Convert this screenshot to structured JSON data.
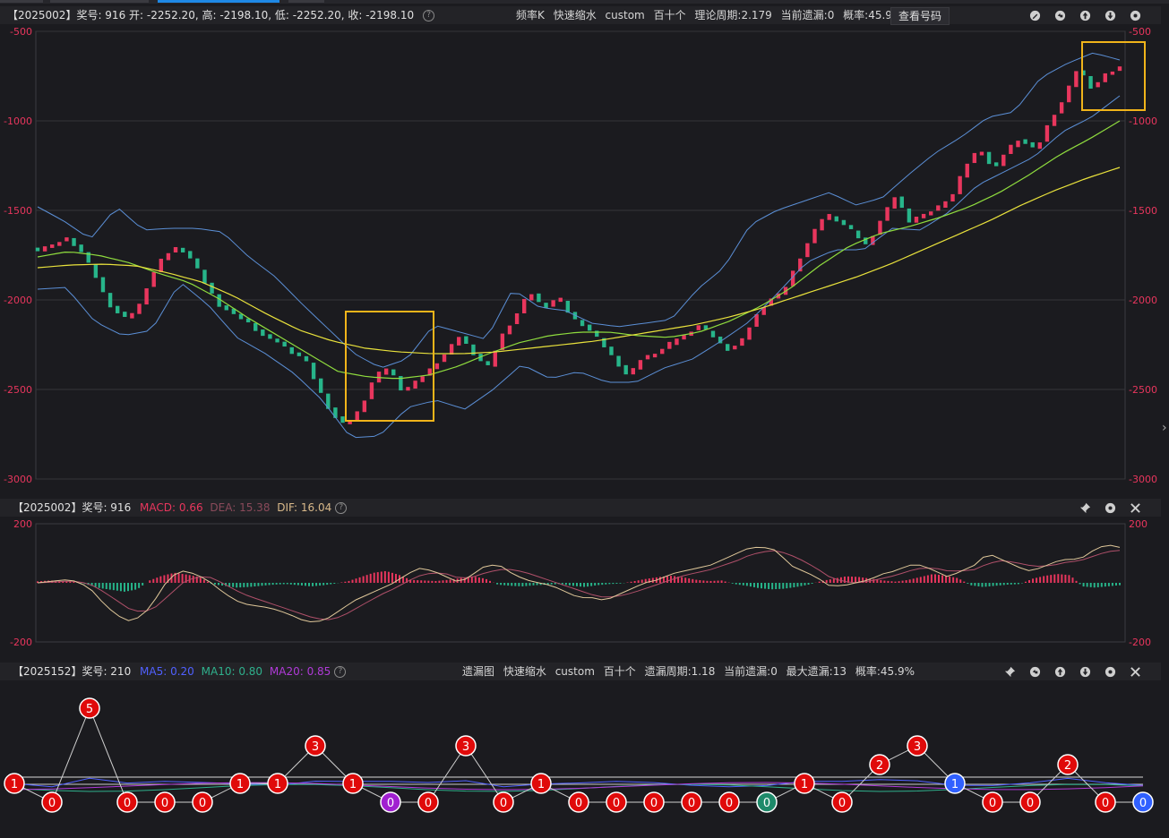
{
  "price_panel": {
    "info": "【2025002】奖号: 916   开: -2252.20, 高: -2198.10, 低: -2252.20, 收: -2198.10",
    "mode_items": [
      "频率K",
      "快速缩水",
      "custom",
      "百十个",
      "理论周期:2.179",
      "当前遗漏:0",
      "概率:45.9%"
    ],
    "view_button": "查看号码",
    "y_ticks": [
      "-500",
      "-1000",
      "-1500",
      "-2000",
      "-2500",
      "-3000"
    ]
  },
  "macd_panel": {
    "title": "【2025002】奖号: 916",
    "macd_text": "MACD: 0.66",
    "dea_text": "DEA: 15.38",
    "dif_text": "DIF: 16.04",
    "y_ticks": [
      "200",
      "-200"
    ]
  },
  "miss_panel": {
    "title": "【2025152】奖号: 210",
    "ma5_text": "MA5: 0.20",
    "ma10_text": "MA10: 0.80",
    "ma20_text": "MA20: 0.85",
    "mode_items": [
      "遗漏图",
      "快速缩水",
      "custom",
      "百十个",
      "遗漏周期:1.18",
      "当前遗漏:0",
      "最大遗漏:13",
      "概率:45.9%"
    ]
  },
  "colors": {
    "up": "#e8365d",
    "down": "#27b58a",
    "ma_yellow": "#e9e23c",
    "ma_green": "#8fdc3e",
    "boll": "#5b8fd6",
    "highlight": "#f0b41a",
    "macd_label": "#e8365d",
    "dea_label": "#8a4a5a",
    "dif_label": "#d9b98a",
    "ma5_label": "#5060ff",
    "ma10_label": "#2fb08c",
    "ma20_label": "#b03ad8",
    "node_red": "#e00a0a",
    "node_purple": "#a020d0",
    "node_green": "#1e8a6a",
    "node_blue": "#3060ff"
  },
  "chart_data": [
    {
      "type": "candlestick",
      "title": "",
      "ylim": [
        -3000,
        -500
      ],
      "yticks": [
        -500,
        -1000,
        -1500,
        -2000,
        -2500,
        -3000
      ],
      "grid": true,
      "last_bar": {
        "open": -2252.2,
        "high": -2198.1,
        "low": -2252.2,
        "close": -2198.1
      },
      "close_path": [
        -1720,
        -1700,
        -1650,
        -1720,
        -1850,
        -2020,
        -2100,
        -2070,
        -1880,
        -1750,
        -1700,
        -1780,
        -1920,
        -2040,
        -2080,
        -2130,
        -2200,
        -2230,
        -2290,
        -2330,
        -2500,
        -2650,
        -2700,
        -2600,
        -2420,
        -2380,
        -2520,
        -2450,
        -2380,
        -2300,
        -2200,
        -2300,
        -2380,
        -2200,
        -2090,
        -1950,
        -2050,
        -1980,
        -2100,
        -2150,
        -2230,
        -2330,
        -2430,
        -2320,
        -2300,
        -2240,
        -2200,
        -2140,
        -2200,
        -2280,
        -2240,
        -2100,
        -2000,
        -1960,
        -1800,
        -1650,
        -1520,
        -1560,
        -1620,
        -1700,
        -1550,
        -1420,
        -1560,
        -1530,
        -1480,
        -1430,
        -1250,
        -1150,
        -1280,
        -1150,
        -1100,
        -1170,
        -1000,
        -880,
        -700,
        -820,
        -740,
        -700
      ],
      "ma_yellow": [
        -1820,
        -1805,
        -1800,
        -1810,
        -1850,
        -1900,
        -1980,
        -2080,
        -2170,
        -2230,
        -2270,
        -2290,
        -2300,
        -2300,
        -2290,
        -2270,
        -2250,
        -2230,
        -2200,
        -2170,
        -2140,
        -2100,
        -2050,
        -1990,
        -1930,
        -1870,
        -1800,
        -1720,
        -1640,
        -1560,
        -1470,
        -1390,
        -1320,
        -1260
      ],
      "ma_green": [
        -1760,
        -1730,
        -1750,
        -1790,
        -1850,
        -1900,
        -1990,
        -2100,
        -2200,
        -2300,
        -2400,
        -2430,
        -2440,
        -2420,
        -2370,
        -2300,
        -2240,
        -2200,
        -2180,
        -2180,
        -2200,
        -2210,
        -2180,
        -2120,
        -2040,
        -1940,
        -1810,
        -1700,
        -1630,
        -1590,
        -1540,
        -1480,
        -1400,
        -1300,
        -1190,
        -1100,
        -1000
      ],
      "boll_upper": [
        -1480,
        -1560,
        -1660,
        -1480,
        -1610,
        -1600,
        -1600,
        -1620,
        -1760,
        -1870,
        -2020,
        -2160,
        -2300,
        -2380,
        -2330,
        -2140,
        -2180,
        -2220,
        -1940,
        -2040,
        -2060,
        -2130,
        -2150,
        -2130,
        -2110,
        -1940,
        -1820,
        -1580,
        -1500,
        -1450,
        -1400,
        -1470,
        -1430,
        -1300,
        -1180,
        -1090,
        -980,
        -950,
        -760,
        -680,
        -620,
        -660
      ],
      "boll_lower": [
        -1940,
        -1930,
        -2120,
        -2200,
        -2170,
        -1900,
        -2030,
        -2210,
        -2300,
        -2410,
        -2560,
        -2770,
        -2760,
        -2600,
        -2560,
        -2610,
        -2500,
        -2360,
        -2440,
        -2400,
        -2460,
        -2460,
        -2380,
        -2330,
        -2230,
        -2120,
        -1960,
        -1790,
        -1720,
        -1720,
        -1600,
        -1610,
        -1510,
        -1360,
        -1280,
        -1200,
        -1060,
        -980,
        -860
      ]
    },
    {
      "type": "macd",
      "ylim": [
        -200,
        200
      ],
      "yticks": [
        200,
        -200
      ],
      "series": [
        {
          "name": "MACD",
          "value": 0.66
        },
        {
          "name": "DEA",
          "value": 15.38
        },
        {
          "name": "DIF",
          "value": 16.04
        }
      ],
      "hist": [
        5,
        8,
        6,
        4,
        -6,
        -18,
        -24,
        -30,
        -22,
        8,
        24,
        34,
        28,
        20,
        -4,
        -10,
        -16,
        -14,
        -10,
        -6,
        -4,
        -8,
        -12,
        -8,
        -2,
        6,
        20,
        34,
        40,
        28,
        10,
        8,
        6,
        10,
        16,
        22,
        14,
        -6,
        -10,
        -12,
        -8,
        -6,
        -4,
        -10,
        -14,
        -8,
        -4,
        -2,
        6,
        14,
        20,
        24,
        18,
        10,
        6,
        8,
        -4,
        -10,
        -18,
        -22,
        -20,
        -14,
        -6,
        6,
        14,
        22,
        20,
        14,
        8,
        4,
        10,
        20,
        30,
        24,
        16,
        -8,
        -14,
        -10,
        -6,
        -4,
        14,
        24,
        30,
        26,
        -12,
        -16,
        -12,
        -8
      ],
      "dif": [
        0,
        5,
        10,
        5,
        -20,
        -70,
        -110,
        -130,
        -110,
        -50,
        20,
        40,
        30,
        5,
        -30,
        -60,
        -75,
        -80,
        -90,
        -105,
        -125,
        -135,
        -120,
        -90,
        -60,
        -40,
        -20,
        0,
        30,
        50,
        40,
        20,
        0,
        30,
        60,
        60,
        30,
        10,
        0,
        -10,
        -30,
        -50,
        -50,
        -60,
        -40,
        -20,
        0,
        10,
        30,
        40,
        50,
        60,
        80,
        100,
        120,
        120,
        110,
        60,
        40,
        20,
        -10,
        -10,
        0,
        10,
        30,
        40,
        60,
        60,
        40,
        20,
        40,
        60,
        100,
        80,
        60,
        40,
        50,
        70,
        80,
        80,
        110,
        130,
        120
      ],
      "dea": [
        0,
        2,
        5,
        5,
        -5,
        -30,
        -60,
        -90,
        -100,
        -80,
        -40,
        0,
        20,
        20,
        0,
        -25,
        -45,
        -60,
        -75,
        -90,
        -105,
        -120,
        -125,
        -115,
        -90,
        -65,
        -40,
        -20,
        5,
        25,
        35,
        30,
        15,
        20,
        35,
        45,
        45,
        35,
        20,
        5,
        -10,
        -25,
        -40,
        -50,
        -45,
        -35,
        -20,
        -5,
        10,
        25,
        35,
        45,
        60,
        75,
        95,
        105,
        110,
        95,
        75,
        50,
        20,
        5,
        0,
        5,
        15,
        25,
        40,
        50,
        50,
        40,
        40,
        45,
        65,
        75,
        70,
        60,
        55,
        60,
        70,
        75,
        90,
        105,
        110
      ]
    },
    {
      "type": "line",
      "title": "",
      "points": [
        1,
        0,
        5,
        0,
        0,
        0,
        1,
        1,
        3,
        1,
        0,
        0,
        3,
        0,
        1,
        0,
        0,
        0,
        0,
        0,
        0,
        1,
        0,
        2,
        3,
        1,
        0,
        0,
        2,
        0,
        0
      ],
      "point_colors": [
        "red",
        "red",
        "red",
        "red",
        "red",
        "red",
        "red",
        "red",
        "red",
        "red",
        "purple",
        "red",
        "red",
        "red",
        "red",
        "red",
        "red",
        "red",
        "red",
        "red",
        "green",
        "red",
        "red",
        "red",
        "red",
        "blue",
        "red",
        "red",
        "red",
        "red",
        "blue"
      ],
      "series": [
        {
          "name": "MA5",
          "value": 0.2
        },
        {
          "name": "MA10",
          "value": 0.8
        },
        {
          "name": "MA20",
          "value": 0.85
        }
      ]
    }
  ]
}
